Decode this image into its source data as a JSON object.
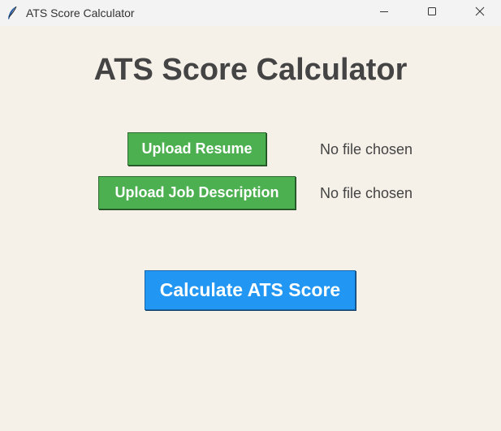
{
  "window": {
    "title": "ATS Score Calculator",
    "icon": "feather-icon",
    "controls": {
      "minimize": "minimize-icon",
      "maximize": "maximize-icon",
      "close": "close-icon"
    }
  },
  "main": {
    "heading": "ATS Score Calculator",
    "upload_resume": {
      "label": "Upload Resume",
      "status": "No file chosen"
    },
    "upload_job_description": {
      "label": "Upload Job Description",
      "status": "No file chosen"
    },
    "calculate": {
      "label": "Calculate ATS Score"
    }
  },
  "colors": {
    "background": "#f5f0e8",
    "upload_button": "#4caf50",
    "calculate_button": "#2196f3",
    "heading_text": "#444444"
  }
}
